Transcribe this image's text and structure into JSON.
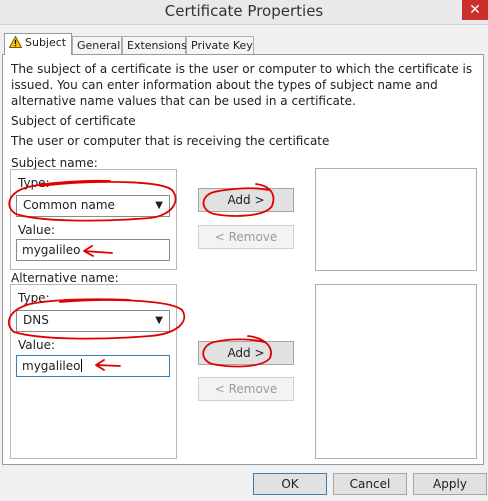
{
  "window": {
    "title": "Certificate Properties",
    "close_glyph": "✕"
  },
  "tabs": [
    {
      "label": "Subject"
    },
    {
      "label": "General"
    },
    {
      "label": "Extensions"
    },
    {
      "label": "Private Key"
    }
  ],
  "subject_tab": {
    "description": "The subject of a certificate is the user or computer to which the certificate is issued. You can enter information about the types of subject name and alternative name values that can be used in a certificate.",
    "subject_heading": "Subject of certificate",
    "subject_info": "The user or computer that is receiving the certificate",
    "subject_name": {
      "label": "Subject name:",
      "type_label": "Type:",
      "type_value": "Common name",
      "value_label": "Value:",
      "value": "mygalileo",
      "add_label": "Add >",
      "remove_label": "< Remove"
    },
    "alternative_name": {
      "label": "Alternative name:",
      "type_label": "Type:",
      "type_value": "DNS",
      "value_label": "Value:",
      "value": "mygalileo",
      "add_label": "Add >",
      "remove_label": "< Remove"
    }
  },
  "footer": {
    "ok": "OK",
    "cancel": "Cancel",
    "apply": "Apply"
  },
  "colors": {
    "annotation": "#e00000",
    "close": "#c9302c",
    "focus": "#3c7fb1"
  },
  "icons": {
    "subject_tab": "warning-icon",
    "dropdown": "chevron-down-icon",
    "close": "close-icon"
  }
}
